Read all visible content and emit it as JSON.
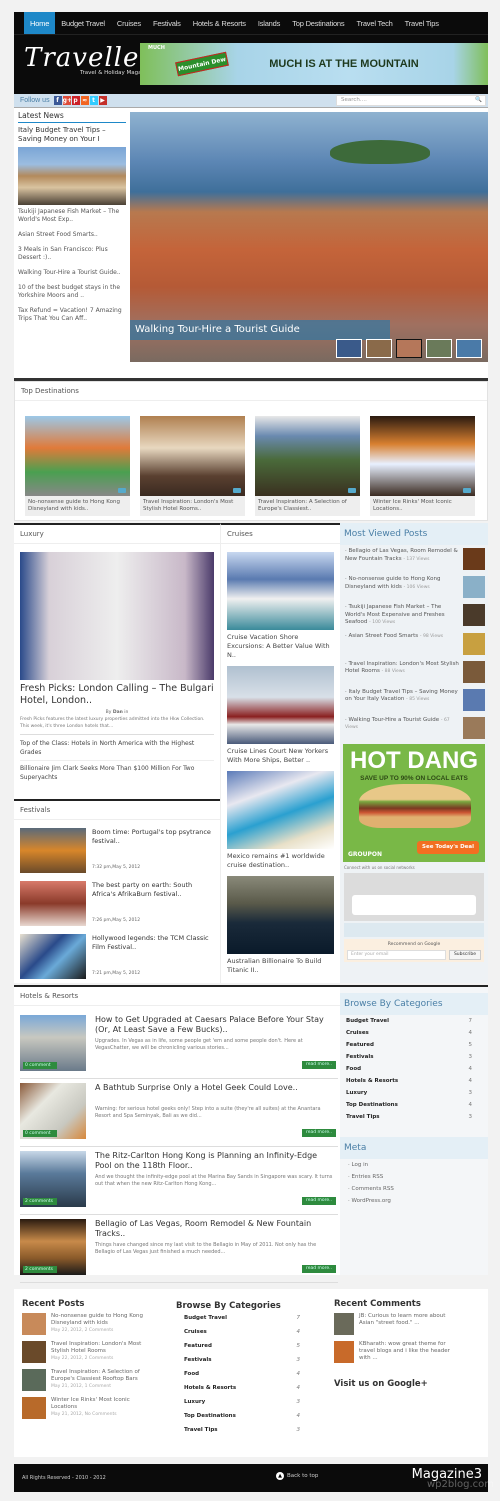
{
  "nav": {
    "items": [
      "Home",
      "Budget Travel",
      "Cruises",
      "Festivals",
      "Hotels & Resorts",
      "Islands",
      "Top Destinations",
      "Travel Tech",
      "Travel Tips"
    ],
    "active": "Home"
  },
  "header": {
    "logo_title": "Traveller",
    "logo_subtitle": "Travel & Holiday Magazine",
    "banner_brand_small": "MUCH",
    "banner_logo": "Mountain Dew",
    "banner_text": "MUCH IS AT THE MOUNTAIN"
  },
  "followbar": {
    "label": "Follow us",
    "icons": [
      "facebook-icon",
      "google-plus-icon",
      "pinterest-icon",
      "rss-icon",
      "twitter-icon",
      "youtube-icon"
    ],
    "icon_glyphs": [
      "f",
      "g+",
      "p",
      "≈",
      "t",
      "▶"
    ],
    "icon_colors": [
      "#3b5998",
      "#dd4b39",
      "#cb2027",
      "#f26522",
      "#33ccff",
      "#c4302b"
    ],
    "search_placeholder": "Search....",
    "search_icon": "🔍"
  },
  "latest_news": {
    "title": "Latest News",
    "featured": "Italy Budget Travel Tips – Saving Money on Your I",
    "items": [
      "Tsukiji Japanese Fish Market – The World's Most Exp..",
      "Asian Street Food Smarts..",
      "3 Meals in San Francisco: Plus Dessert :)..",
      "Walking Tour-Hire a Tourist Guide..",
      "10 of the best budget stays in the Yorkshire Moors and ..",
      "Tax Refund = Vacation! 7 Amazing Trips That You Can Aff.."
    ]
  },
  "slider": {
    "caption": "Walking Tour-Hire a Tourist Guide",
    "thumb_count": 5,
    "selected_thumb": 3
  },
  "top_destinations": {
    "title": "Top Destinations",
    "items": [
      {
        "caption": "No-nonsense guide to Hong Kong Disneyland with kids..",
        "comments": "2"
      },
      {
        "caption": "Travel Inspiration: London's Most Stylish Hotel Rooms..",
        "comments": "2"
      },
      {
        "caption": "Travel Inspiration: A Selection of Europe's Classiest..",
        "comments": "1"
      },
      {
        "caption": "Winter Ice Rinks' Most Iconic Locations..",
        "comments": "0"
      }
    ]
  },
  "luxury": {
    "title": "Luxury",
    "headline": "Fresh Picks: London Calling – The Bulgari Hotel, London..",
    "byline_prefix": "By",
    "author": "Dan",
    "byline_suffix": "in",
    "excerpt": "Fresh Picks features the latest luxury properties admitted into the Hkw Collection. This week, it's three London hotels that...",
    "links": [
      "Top of the Class: Hotels in North America with the Highest Grades",
      "Billionaire Jim Clark Seeks More Than $100 Million For Two Superyachts"
    ]
  },
  "cruises": {
    "title": "Cruises",
    "items": [
      "Cruise Vacation Shore Excursions: A Better Value With N..",
      "Cruise Lines Court New Yorkers With More Ships, Better ..",
      "Mexico remains #1 worldwide cruise destination..",
      "Australian Billionaire To Build Titanic II.."
    ]
  },
  "festivals": {
    "title": "Festivals",
    "items": [
      {
        "title": "Boom time: Portugal's top psytrance festival..",
        "date": "7:32 pm,May 5, 2012"
      },
      {
        "title": "The best party on earth: South Africa's AfrikaBurn festival..",
        "date": "7:26 pm,May 5, 2012"
      },
      {
        "title": "Hollywood legends: the TCM Classic Film Festival..",
        "date": "7:21 pm,May 5, 2012"
      }
    ]
  },
  "most_viewed": {
    "title": "Most Viewed Posts",
    "items": [
      {
        "title": "Bellagio of Las Vegas, Room Remodel & New Fountain Tracks",
        "views": "- 137 Views"
      },
      {
        "title": "No-nonsense guide to Hong Kong Disneyland with kids",
        "views": "- 106 Views"
      },
      {
        "title": "Tsukiji Japanese Fish Market – The World's Most Expensive and Freshes Seafood",
        "views": "- 100 Views"
      },
      {
        "title": "Asian Street Food Smarts",
        "views": "- 98 Views"
      },
      {
        "title": "Travel Inspiration: London's Most Stylish Hotel Rooms",
        "views": "- 88 Views"
      },
      {
        "title": "Italy Budget Travel Tips – Saving Money on Your Italy Vacation",
        "views": "- 85 Views"
      },
      {
        "title": "Walking Tour-Hire a Tourist Guide",
        "views": "- 67 Views"
      }
    ]
  },
  "ad": {
    "headline": "HOT DANG",
    "sub": "SAVE UP TO 90% ON LOCAL EATS",
    "brand": "GROUPON",
    "cta": "See Today's Deal"
  },
  "social_widget": {
    "label": "Connect with us on social networks",
    "recommend": "Recommend on Google",
    "email_placeholder": "Enter your email",
    "subscribe": "Subscribe"
  },
  "hotels": {
    "title": "Hotels & Resorts",
    "read_more": "read more..",
    "items": [
      {
        "title": "How to Get Upgraded at Caesars Palace Before Your Stay (Or, At Least Save a Few Bucks)..",
        "excerpt": "Upgrades. In Vegas as in life, some people get 'em and some people don't. Here at VegasChatter, we will be chronicling various stories...",
        "comments": "0 comment"
      },
      {
        "title": "A Bathtub Surprise Only a Hotel Geek Could Love..",
        "excerpt": "Warning: for serious hotel geeks only! Step into a suite (they're all suites) at the Anantara Resort and Spa Seminyak, Bali as we did...",
        "comments": "0 comment"
      },
      {
        "title": "The Ritz-Carlton Hong Kong is Planning an Infinity-Edge Pool on the 118th Floor..",
        "excerpt": "And we thought the infinity-edge pool at the Marina Bay Sands in Singapore was scary. It turns out that when the new Ritz-Carlton Hong Kong...",
        "comments": "2 comments"
      },
      {
        "title": "Bellagio of Las Vegas, Room Remodel & New Fountain Tracks..",
        "excerpt": "Things have changed since my last visit to the Bellagio in May of 2011. Not only has the Bellagio of Las Vegas just finished a much needed...",
        "comments": "2 comments"
      }
    ]
  },
  "categories": {
    "title": "Browse By Categories",
    "items": [
      {
        "name": "Budget Travel",
        "count": "7"
      },
      {
        "name": "Cruises",
        "count": "4"
      },
      {
        "name": "Featured",
        "count": "5"
      },
      {
        "name": "Festivals",
        "count": "3"
      },
      {
        "name": "Food",
        "count": "4"
      },
      {
        "name": "Hotels & Resorts",
        "count": "4"
      },
      {
        "name": "Luxury",
        "count": "3"
      },
      {
        "name": "Top Destinations",
        "count": "4"
      },
      {
        "name": "Travel Tips",
        "count": "3"
      }
    ]
  },
  "meta": {
    "title": "Meta",
    "items": [
      "Log in",
      "Entries RSS",
      "Comments RSS",
      "WordPress.org"
    ]
  },
  "footer": {
    "recent_posts_title": "Recent Posts",
    "recent_posts": [
      {
        "title": "No-nonsense guide to Hong Kong Disneyland with kids",
        "meta": "May 22, 2012, 2 Comments"
      },
      {
        "title": "Travel Inspiration: London's Most Stylish Hotel Rooms",
        "meta": "May 22, 2012, 2 Comments"
      },
      {
        "title": "Travel Inspiration: A Selection of Europe's Classiest Rooftop Bars",
        "meta": "May 21, 2012, 1 Comment"
      },
      {
        "title": "Winter Ice Rinks' Most Iconic Locations",
        "meta": "May 21, 2012, No Comments"
      }
    ],
    "recent_comments_title": "Recent Comments",
    "recent_comments": [
      {
        "text": "JB: Curious to learn more about Asian \"street food.\" ..."
      },
      {
        "text": "KBharath: wow great theme for travel blogs and i like the header with ..."
      }
    ],
    "google_plus": "Visit us on Google+",
    "copyright": "All Rights Reserved - 2010 - 2012",
    "back_to_top": "Back to top",
    "brand": "Magazine3",
    "watermark": "wp2blog.com"
  }
}
